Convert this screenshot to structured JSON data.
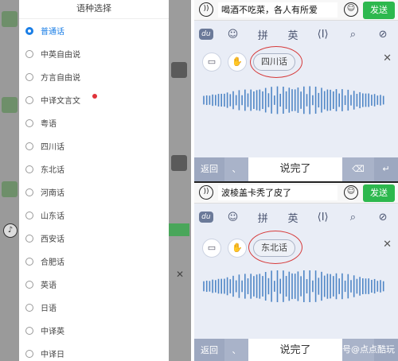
{
  "sheet": {
    "title": "语种选择",
    "options": [
      {
        "label": "普通话",
        "selected": true
      },
      {
        "label": "中英自由说"
      },
      {
        "label": "方言自由说"
      },
      {
        "label": "中译文言文",
        "badge": true
      },
      {
        "label": "粤语"
      },
      {
        "label": "四川话"
      },
      {
        "label": "东北话"
      },
      {
        "label": "河南话"
      },
      {
        "label": "山东话"
      },
      {
        "label": "西安话"
      },
      {
        "label": "合肥话"
      },
      {
        "label": "英语"
      },
      {
        "label": "日语"
      },
      {
        "label": "中译英"
      },
      {
        "label": "中译日"
      }
    ]
  },
  "panel_top": {
    "input_text": "喝酒不吃菜，各人有所爱",
    "send_label": "发送",
    "toolbar": [
      "du",
      "☺",
      "拼",
      "英",
      "⟨I⟩",
      "⌕",
      "⊘"
    ],
    "dialect_pill": "四川话",
    "back_label": "返回",
    "separator": "、",
    "done_label": "说完了"
  },
  "panel_bottom": {
    "input_text": "波棱盖卡秃了皮了",
    "send_label": "发送",
    "toolbar": [
      "du",
      "☺",
      "拼",
      "英",
      "⟨I⟩",
      "⌕",
      "⊘"
    ],
    "dialect_pill": "东北话",
    "back_label": "返回",
    "separator": "、",
    "done_label": "说完了",
    "watermark": "搜狐号@点点酷玩"
  },
  "colors": {
    "accent_blue": "#1a7ee6",
    "send_green": "#2db84e",
    "wave_blue": "#4f86c6",
    "annotation_red": "#d63a3a"
  }
}
